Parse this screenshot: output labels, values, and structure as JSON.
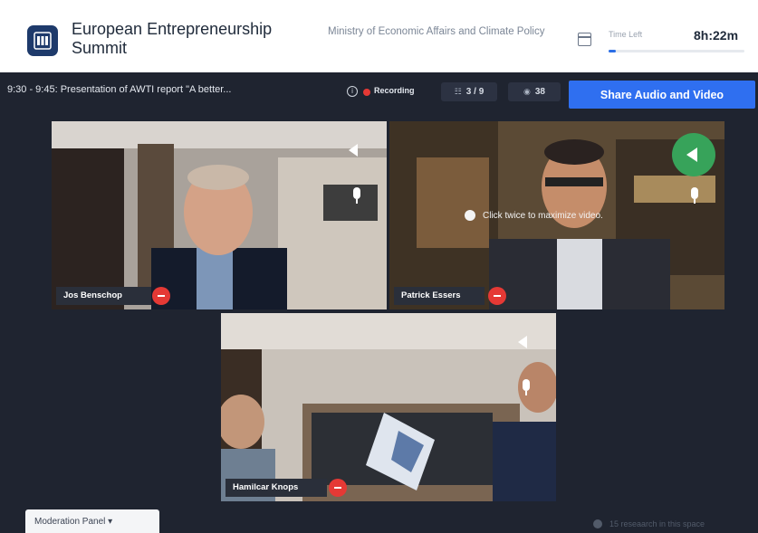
{
  "header": {
    "event_title": "European Entrepreneurship Summit",
    "ministry": "Ministry of Economic Affairs and Climate Policy",
    "time_left_label": "Time Left",
    "time_left_value": "8h:22m",
    "time_progress": 0.05
  },
  "toolbar": {
    "session": "9:30 - 9:45: Presentation of AWTI report \"A better...",
    "recording_label": "Recording",
    "participants_badge": "3 / 9",
    "viewers_badge": "38",
    "share_button": "Share Audio and Video"
  },
  "videos": [
    {
      "name": "Jos Benschop"
    },
    {
      "name": "Patrick Essers",
      "hint": "Click twice to maximize video."
    },
    {
      "name": "Hamilcar Knops"
    }
  ],
  "footer": {
    "moderation_panel": "Moderation Panel",
    "attendees_note": "15 reseaarch in this space"
  },
  "colors": {
    "accent": "#2f6ff0",
    "mute": "#e53935",
    "active_speaker": "#37a35a",
    "background": "#1f2430"
  },
  "icons": [
    "calendar-icon",
    "info-icon",
    "recording-dot-icon",
    "users-icon",
    "eye-icon",
    "speaker-icon",
    "mic-icon",
    "mute-icon",
    "chevron-down-icon"
  ]
}
